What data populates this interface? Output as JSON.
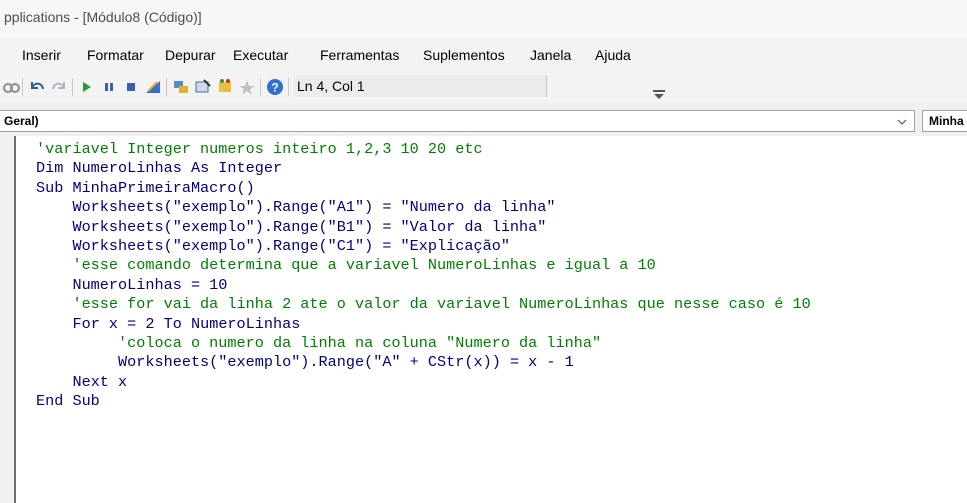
{
  "window": {
    "title": "pplications - [Módulo8 (Código)]"
  },
  "menu": [
    {
      "label": "Inserir"
    },
    {
      "label": "Formatar"
    },
    {
      "label": "Depurar"
    },
    {
      "label": "Executar"
    },
    {
      "label": "Ferramentas"
    },
    {
      "label": "Suplementos"
    },
    {
      "label": "Janela"
    },
    {
      "label": "Ajuda"
    }
  ],
  "toolbar": {
    "icons": [
      "find-icon",
      "undo-icon",
      "redo-icon",
      "run-icon",
      "break-icon",
      "reset-icon",
      "design-mode-icon",
      "project-explorer-icon",
      "properties-icon",
      "object-browser-icon",
      "toolbox-icon",
      "help-icon"
    ],
    "position_label": "Ln 4, Col 1"
  },
  "combos": {
    "object": "Geral)",
    "procedure": "Minha"
  },
  "colors": {
    "keyword": "#00008b",
    "comment": "#008000",
    "text": "#000080"
  },
  "code": {
    "lines": [
      [
        {
          "t": "'variavel Integer numeros inteiro 1,2,3 10 20 etc",
          "c": "cm"
        }
      ],
      [
        {
          "t": "Dim",
          "c": "kw"
        },
        {
          "t": " NumeroLinhas ",
          "c": "tx"
        },
        {
          "t": "As Integer",
          "c": "kw"
        }
      ],
      [
        {
          "t": "Sub",
          "c": "kw"
        },
        {
          "t": " MinhaPrimeiraMacro()",
          "c": "tx"
        }
      ],
      [
        {
          "t": "    Worksheets(\"exemplo\").Range(\"A1\") = \"Numero da linha\"",
          "c": "tx"
        }
      ],
      [
        {
          "t": "    Worksheets(\"exemplo\").Range(\"B1\") = \"Valor da linha\"",
          "c": "tx"
        }
      ],
      [
        {
          "t": "    Worksheets(\"exemplo\").Range(\"C1\") = \"Explicação\"",
          "c": "tx"
        }
      ],
      [
        {
          "t": "    'esse comando determina que a variavel NumeroLinhas e igual a 10",
          "c": "cm"
        }
      ],
      [
        {
          "t": "    NumeroLinhas = 10",
          "c": "tx"
        }
      ],
      [
        {
          "t": "    'esse for vai da linha 2 ate o valor da variavel NumeroLinhas que nesse caso é 10",
          "c": "cm"
        }
      ],
      [
        {
          "t": "    ",
          "c": "tx"
        },
        {
          "t": "For",
          "c": "kw"
        },
        {
          "t": " x = 2 ",
          "c": "tx"
        },
        {
          "t": "To",
          "c": "kw"
        },
        {
          "t": " NumeroLinhas",
          "c": "tx"
        }
      ],
      [
        {
          "t": "         'coloca o numero da linha na coluna \"Numero da linha\"",
          "c": "cm"
        }
      ],
      [
        {
          "t": "         Worksheets(\"exemplo\").Range(\"A\" + ",
          "c": "tx"
        },
        {
          "t": "CStr",
          "c": "kw"
        },
        {
          "t": "(x)) = x - 1",
          "c": "tx"
        }
      ],
      [
        {
          "t": "    ",
          "c": "tx"
        },
        {
          "t": "Next",
          "c": "kw"
        },
        {
          "t": " x",
          "c": "tx"
        }
      ],
      [
        {
          "t": "End Sub",
          "c": "kw"
        }
      ]
    ]
  }
}
